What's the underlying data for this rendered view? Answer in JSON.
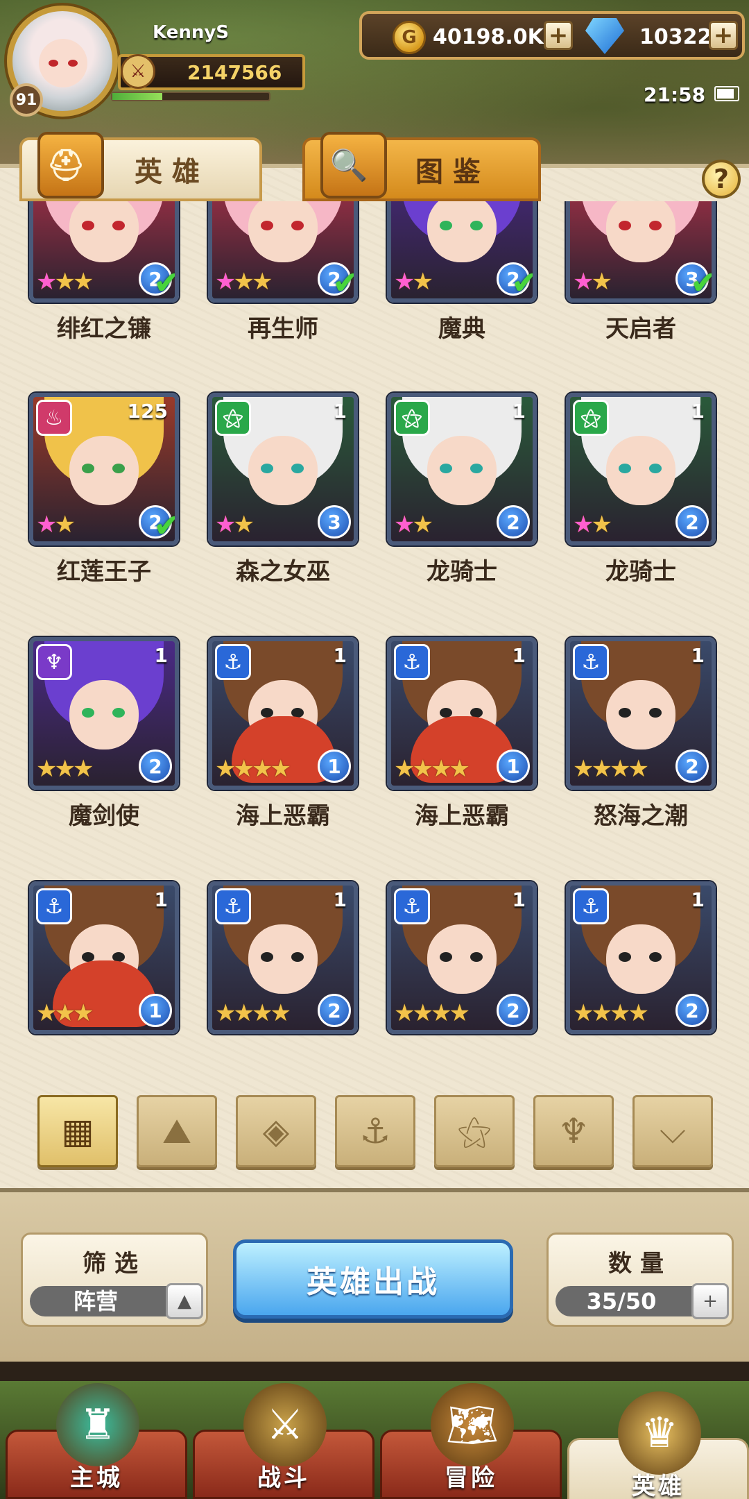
{
  "player": {
    "name": "KennyS",
    "level": "91",
    "power": "2147566",
    "xp_fraction": 0.32
  },
  "currency": {
    "gold": "40198.0K",
    "gems": "10322"
  },
  "status": {
    "time": "21:58"
  },
  "tabs": [
    {
      "label": "英雄"
    },
    {
      "label": "图鉴"
    }
  ],
  "help_label": "?",
  "colors": {
    "accent": "#4aa6ee",
    "panel": "#efe6d2",
    "card_border": "#4a5a7a"
  },
  "heroes": [
    {
      "name": "绯红之镰",
      "faction_icon": "crimson",
      "count": "",
      "stars": "★★",
      "rainbow_star": true,
      "grade": "2",
      "check": true
    },
    {
      "name": "再生师",
      "faction_icon": "crimson",
      "count": "",
      "stars": "★★",
      "rainbow_star": true,
      "grade": "2",
      "check": true
    },
    {
      "name": "魔典",
      "faction_icon": "shadow",
      "count": "",
      "stars": "★",
      "rainbow_star": true,
      "grade": "2",
      "check": true
    },
    {
      "name": "天启者",
      "faction_icon": "crimson",
      "count": "",
      "stars": "★",
      "rainbow_star": true,
      "grade": "3",
      "check": true
    },
    {
      "name": "红莲王子",
      "faction_icon": "fire",
      "count": "125",
      "stars": "★",
      "rainbow_star": true,
      "grade": "2",
      "check": true
    },
    {
      "name": "森之女巫",
      "faction_icon": "beast",
      "count": "1",
      "stars": "★",
      "rainbow_star": true,
      "grade": "3",
      "check": false
    },
    {
      "name": "龙骑士",
      "faction_icon": "beast",
      "count": "1",
      "stars": "★",
      "rainbow_star": true,
      "grade": "2",
      "check": false
    },
    {
      "name": "龙骑士",
      "faction_icon": "beast",
      "count": "1",
      "stars": "★",
      "rainbow_star": true,
      "grade": "2",
      "check": false
    },
    {
      "name": "魔剑使",
      "faction_icon": "shadow",
      "count": "1",
      "stars": "★★★",
      "rainbow_star": false,
      "grade": "2",
      "check": false
    },
    {
      "name": "海上恶霸",
      "faction_icon": "anchor",
      "count": "1",
      "stars": "★★★★",
      "rainbow_star": false,
      "grade": "1",
      "check": false
    },
    {
      "name": "海上恶霸",
      "faction_icon": "anchor",
      "count": "1",
      "stars": "★★★★",
      "rainbow_star": false,
      "grade": "1",
      "check": false
    },
    {
      "name": "怒海之潮",
      "faction_icon": "anchor",
      "count": "1",
      "stars": "★★★★",
      "rainbow_star": false,
      "grade": "2",
      "check": false
    },
    {
      "name": "",
      "faction_icon": "anchor",
      "count": "1",
      "stars": "★★★",
      "rainbow_star": false,
      "grade": "1",
      "check": false
    },
    {
      "name": "",
      "faction_icon": "anchor",
      "count": "1",
      "stars": "★★★★",
      "rainbow_star": false,
      "grade": "2",
      "check": false
    },
    {
      "name": "",
      "faction_icon": "anchor",
      "count": "1",
      "stars": "★★★★",
      "rainbow_star": false,
      "grade": "2",
      "check": false
    },
    {
      "name": "",
      "faction_icon": "anchor",
      "count": "1",
      "stars": "★★★★",
      "rainbow_star": false,
      "grade": "2",
      "check": false
    }
  ],
  "filters": {
    "buttons": [
      "all-grid-icon",
      "forest-icon",
      "diamond-faction-icon",
      "anchor-icon",
      "beast-icon",
      "demon-icon",
      "wing-icon"
    ],
    "filter_title": "筛选",
    "filter_value": "阵营",
    "battle_label": "英雄出战",
    "count_title": "数量",
    "count_value": "35/50"
  },
  "nav": [
    {
      "label": "主城",
      "icon": "castle-icon"
    },
    {
      "label": "战斗",
      "icon": "crossed-swords-icon"
    },
    {
      "label": "冒险",
      "icon": "map-icon"
    },
    {
      "label": "英雄",
      "icon": "helmet-icon"
    }
  ]
}
